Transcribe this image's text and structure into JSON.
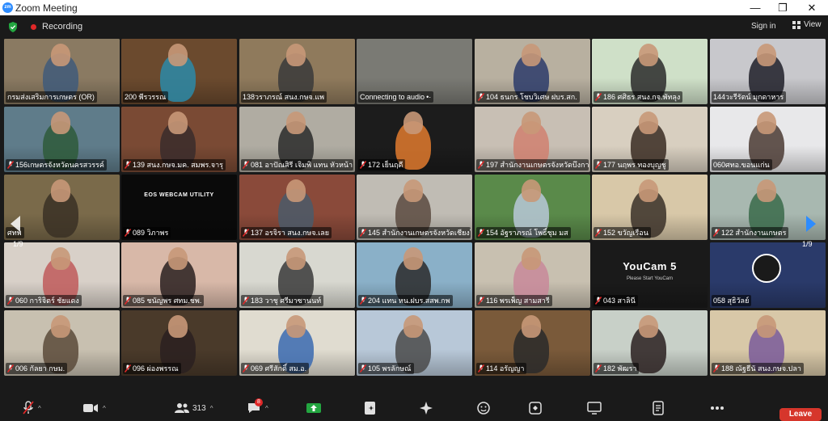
{
  "window": {
    "title": "Zoom Meeting",
    "logo_text": "zm"
  },
  "topbar": {
    "recording_label": "Recording",
    "signin_label": "Sign in",
    "view_label": "View"
  },
  "pagination": {
    "left": "1/9",
    "right": "1/9"
  },
  "tiles": [
    {
      "name": "กรมส่งเสริมการเกษตร (OR)",
      "muted": false,
      "bg": "#8a7a62",
      "accent": "#3f5a7a"
    },
    {
      "name": "200 พีรวรรณ",
      "muted": false,
      "bg": "#6b4a2e",
      "accent": "#2b8aa8"
    },
    {
      "name": "138วราภรณ์ สนง.กษจ.แพ",
      "muted": false,
      "bg": "#8f7a5c",
      "accent": "#3a3a3a"
    },
    {
      "name": "Connecting to audio",
      "muted": false,
      "connecting": true,
      "bg": "#7a7a74",
      "accent": "#555555"
    },
    {
      "name": "104 ธนกร  โชบวิเศษ ฝบร.สก.",
      "muted": true,
      "bg": "#b8b0a0",
      "accent": "#2b3b6a"
    },
    {
      "name": "186 ศศิธร สนง.กจ.พัทลุง",
      "muted": true,
      "bg": "#cfe0c8",
      "accent": "#2a2a2a"
    },
    {
      "name": "144วะรีรัตน์ มุกดาหาร",
      "muted": false,
      "bg": "#c8c8cc",
      "accent": "#1e1e28"
    },
    {
      "name": "156เกษตรจังหวัดนครสวรรค์",
      "muted": true,
      "bg": "#5f7c8a",
      "accent": "#2e5a3a"
    },
    {
      "name": "139 สนง.กษจ.มค. สมพร.จารุ",
      "muted": true,
      "bg": "#7a4a34",
      "accent": "#3a2c2c"
    },
    {
      "name": "081 อาปัณสิรี เจิมพิ แทน หัวหน้า",
      "muted": true,
      "bg": "#b0aca2",
      "accent": "#2a2a2a"
    },
    {
      "name": "172 เย็นฤดี",
      "muted": true,
      "bg": "#1c1c1c",
      "accent": "#e07a2e"
    },
    {
      "name": "197 สำนักงานเกษตรจังหวัดบึงกาฬ",
      "muted": true,
      "bg": "#c8bfb4",
      "accent": "#d08070"
    },
    {
      "name": "177 นฤพร ทองบุญชู",
      "muted": true,
      "bg": "#d8cfc0",
      "accent": "#3a2c22"
    },
    {
      "name": "060ศทอ.ขอนแก่น",
      "muted": false,
      "bg": "#e8e8ea",
      "accent": "#4a3a32"
    },
    {
      "name": "ศทพ",
      "muted": false,
      "bg": "#7a6a4a",
      "accent": "#3a3024"
    },
    {
      "name": "089 วิภาพร",
      "muted": true,
      "bg": "#0a0a0a",
      "accent": "#ffffff",
      "overlay": "EOS WEBCAM UTILITY"
    },
    {
      "name": "137 อรจิรา สนง.กษจ.เลย",
      "muted": true,
      "bg": "#8a4a3a",
      "accent": "#4a5a6a"
    },
    {
      "name": "145 สำนักงานเกษตรจังหวัดเชียงใหม่",
      "muted": true,
      "bg": "#c0bcb4",
      "accent": "#5a4a40"
    },
    {
      "name": "154 อัฐราภรณ์  โพธิ์ชุม มส",
      "muted": true,
      "bg": "#5a8a4a",
      "accent": "#b8c8d8"
    },
    {
      "name": "152 ขวัญเรือน",
      "muted": true,
      "bg": "#d8c8a8",
      "accent": "#3a3028"
    },
    {
      "name": "122 สำนักงานเกษตร",
      "muted": true,
      "bg": "#a8b8b0",
      "accent": "#3a6a4a"
    },
    {
      "name": "060 การิจิตร์ ชัยแดง",
      "muted": true,
      "bg": "#d8d0c8",
      "accent": "#c05a5a"
    },
    {
      "name": "085 ชนัญพร ศทม.ชพ.",
      "muted": true,
      "bg": "#d8b8a8",
      "accent": "#2a2020"
    },
    {
      "name": "183 วาชุ  ศรีมาซานนท์",
      "muted": true,
      "bg": "#d8d8d0",
      "accent": "#3a3a3a"
    },
    {
      "name": "204 แทน หน.ฝบร.สสพ.กพ",
      "muted": true,
      "bg": "#8ab0c8",
      "accent": "#2a2a2a"
    },
    {
      "name": "116 พรเพ็ญ สามสารี",
      "muted": true,
      "bg": "#c8c0b0",
      "accent": "#c8889a"
    },
    {
      "name": "043 สาลินี",
      "muted": true,
      "bg": "#1a1a1a",
      "accent": "#ffffff",
      "overlay": "YouCam 5",
      "overlay_sub": "Please Start YouCam"
    },
    {
      "name": "058 สุธิวัลย์",
      "muted": false,
      "bg": "#2a3a6a",
      "accent": "#ffffff",
      "video_off": true
    },
    {
      "name": "006 กัลยา กษม.",
      "muted": true,
      "bg": "#c8c0b0",
      "accent": "#5a4a3a"
    },
    {
      "name": "096 ผ่องพรรณ",
      "muted": true,
      "bg": "#4a3a2a",
      "accent": "#2a2020"
    },
    {
      "name": "069 ศรีสักดิ์ สม.อ.",
      "muted": true,
      "bg": "#e0dcd0",
      "accent": "#3a6ab0"
    },
    {
      "name": "105 พรลักษณ์",
      "muted": true,
      "bg": "#b8c8d8",
      "accent": "#4a4a4a"
    },
    {
      "name": "114 อรัญญา",
      "muted": true,
      "bg": "#7a5a3a",
      "accent": "#2a2a2a"
    },
    {
      "name": "182 พัฒรา",
      "muted": true,
      "bg": "#c8d0c8",
      "accent": "#2a2020"
    },
    {
      "name": "188 ณัฐธีนั สนง.กษจ.ปลา",
      "muted": true,
      "bg": "#d8c8a8",
      "accent": "#7a5a9a"
    }
  ],
  "toolbar": {
    "participants_count": "313",
    "chat_badge": "8",
    "leave_label": "Leave"
  },
  "icons": {
    "shield": "shield-check-icon",
    "mic": "mic-off-icon",
    "video": "video-camera-icon",
    "participants": "participants-icon",
    "chat": "chat-icon",
    "share": "share-screen-icon",
    "summary": "summary-icon",
    "ai": "ai-companion-icon",
    "reactions": "reactions-icon",
    "apps": "apps-icon",
    "whiteboards": "whiteboards-icon",
    "notes": "notes-icon",
    "more": "more-icon"
  },
  "colors": {
    "accent_green": "#23a640",
    "leave_red": "#d6362b",
    "record_red": "#e02828",
    "active_speaker": "#d9e060",
    "nav_blue": "#2d8cff"
  }
}
